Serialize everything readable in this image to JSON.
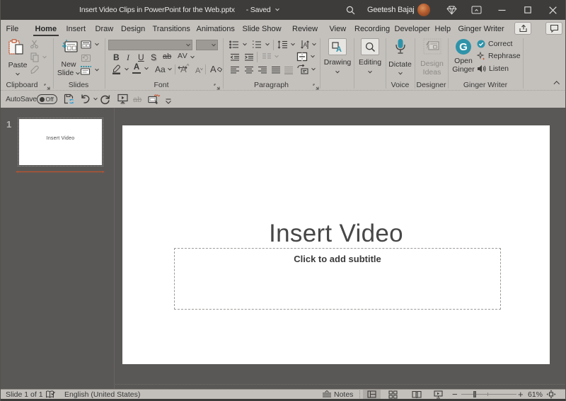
{
  "window": {
    "title": "Insert Video Clips in PowerPoint for the Web.pptx",
    "save_state": "-  Saved",
    "account_name": "Geetesh Bajaj"
  },
  "tabs": [
    {
      "label": "File"
    },
    {
      "label": "Home"
    },
    {
      "label": "Insert"
    },
    {
      "label": "Draw"
    },
    {
      "label": "Design"
    },
    {
      "label": "Transitions"
    },
    {
      "label": "Animations"
    },
    {
      "label": "Slide Show"
    },
    {
      "label": "Review"
    },
    {
      "label": "View"
    },
    {
      "label": "Recording"
    },
    {
      "label": "Developer"
    },
    {
      "label": "Help"
    },
    {
      "label": "Ginger Writer"
    }
  ],
  "ribbon": {
    "clipboard": {
      "paste": "Paste",
      "label": "Clipboard"
    },
    "slides": {
      "new_line1": "New",
      "new_line2": "Slide",
      "label": "Slides"
    },
    "font": {
      "bold": "B",
      "italic": "I",
      "underline": "U",
      "shadow": "S",
      "strike": "ab",
      "spacing": "AV",
      "case": "Aa",
      "grow": "A",
      "shrink": "A",
      "clear": "A",
      "color": "A",
      "label": "Font"
    },
    "paragraph": {
      "label": "Paragraph"
    },
    "drawing": {
      "label": "Drawing"
    },
    "editing": {
      "label": "Editing"
    },
    "voice": {
      "dictate": "Dictate",
      "label": "Voice"
    },
    "designer": {
      "line1": "Design",
      "line2": "Ideas",
      "label": "Designer"
    },
    "ginger": {
      "open_line1": "Open",
      "open_line2": "Ginger",
      "correct": "Correct",
      "rephrase": "Rephrase",
      "listen": "Listen",
      "label": "Ginger Writer"
    }
  },
  "qat": {
    "autosave_label": "AutoSave",
    "autosave_state": "Off"
  },
  "slide_panel": {
    "slide_number": "1",
    "thumb_title": "Insert Video"
  },
  "canvas": {
    "title": "Insert Video",
    "subtitle_placeholder": "Click to add subtitle"
  },
  "status_bar": {
    "slide_info": "Slide 1 of 1",
    "language": "English (United States)",
    "notes_label": "Notes",
    "zoom_level": "61%"
  },
  "colors": {
    "titlebar": "#3d3c3b",
    "ribbon_bg": "#c4c1bd",
    "workspace_bg": "#5a5856",
    "accent_teal": "#2e93a9",
    "accent_orange": "#c0532d"
  }
}
